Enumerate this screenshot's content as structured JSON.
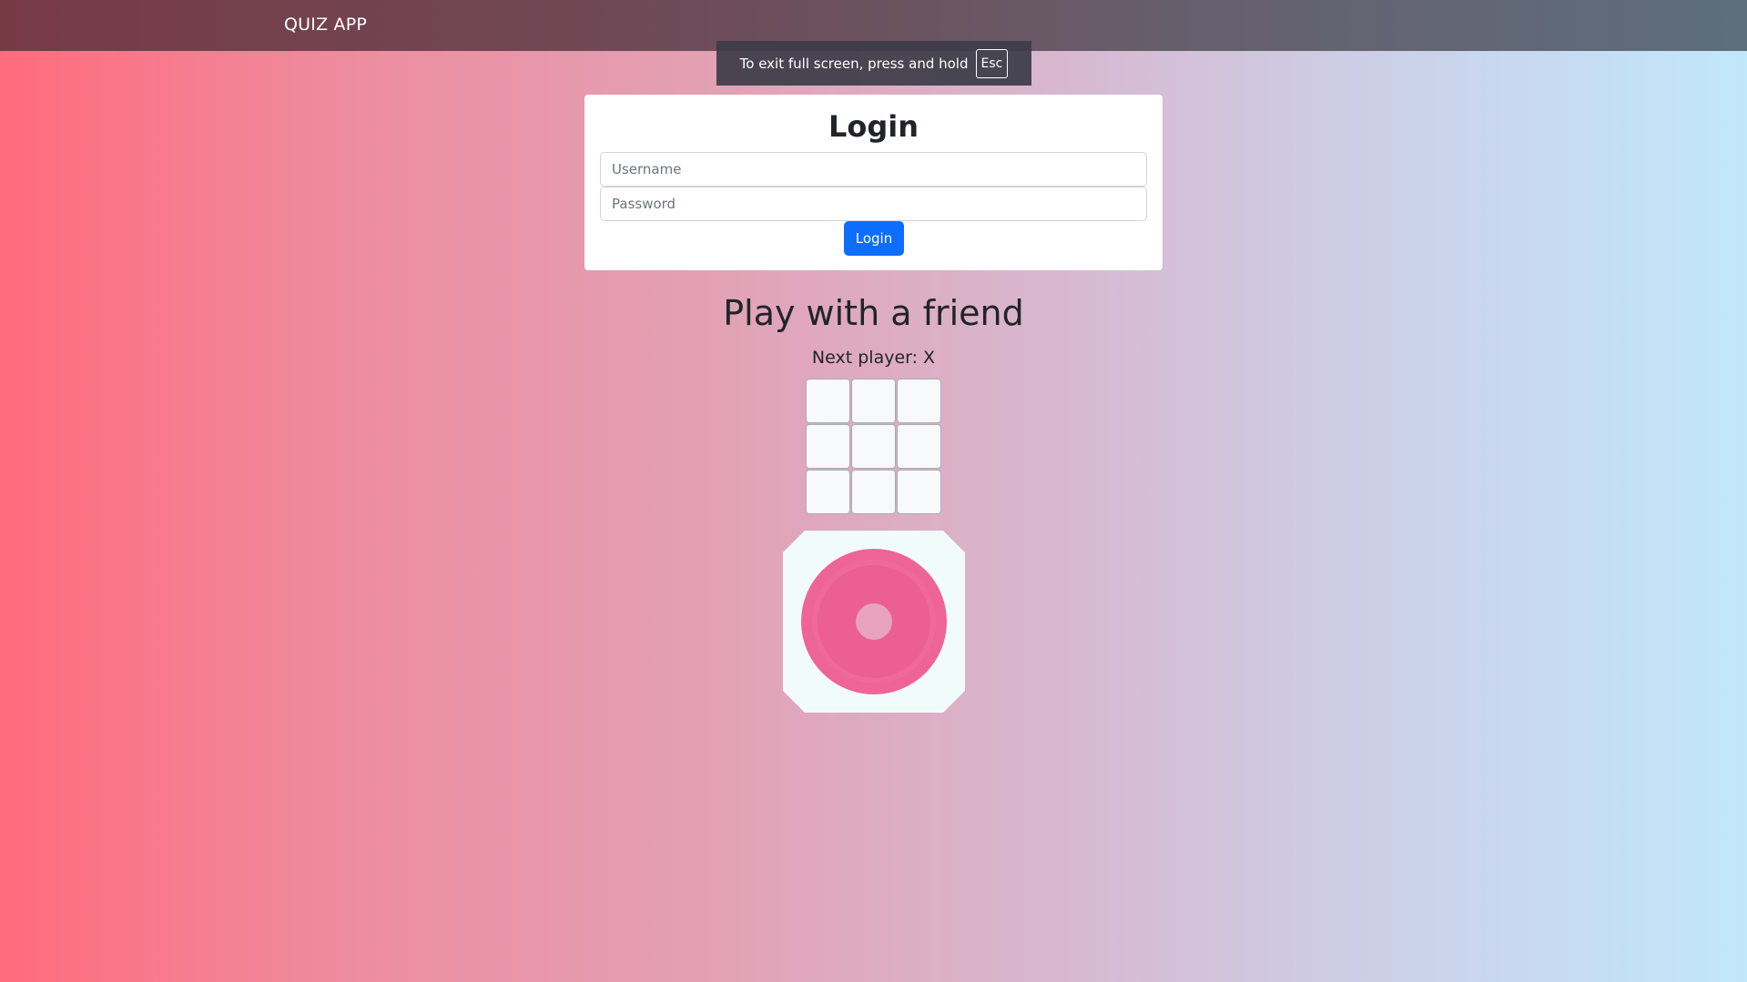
{
  "navbar": {
    "brand": "QUIZ APP"
  },
  "fullscreen_notice": {
    "text": "To exit full screen, press and hold",
    "key": "Esc"
  },
  "login": {
    "title": "Login",
    "username_placeholder": "Username",
    "username_value": "",
    "password_placeholder": "Password",
    "password_value": "",
    "button_label": "Login"
  },
  "game": {
    "title": "Play with a friend",
    "status": "Next player: X",
    "cells": [
      "",
      "",
      "",
      "",
      "",
      "",
      "",
      "",
      ""
    ]
  },
  "loader": {
    "icon": "spinner-icon",
    "colors": {
      "background": "#f0fbfa",
      "ring": "#ee6495",
      "core": "#e8a4bd"
    }
  },
  "colors": {
    "primary_button": "#0d6efd",
    "gradient_left": "#ff6b7d",
    "gradient_right": "#c1e7fb"
  }
}
